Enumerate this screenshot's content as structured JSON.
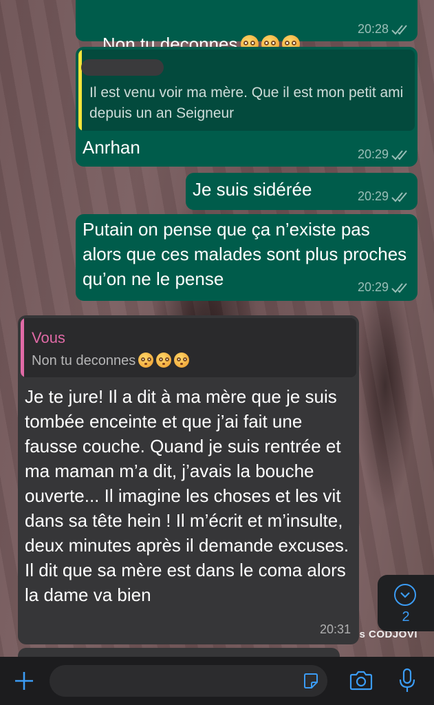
{
  "messages": [
    {
      "text": "Non tu deconnes",
      "emoji": [
        "flushed-face",
        "flushed-face",
        "flushed-face"
      ],
      "time": "20:28"
    },
    {
      "quote": {
        "sender": "",
        "text": "Il est venu voir ma mère. Que il est mon petit ami depuis un an Seigneur"
      },
      "text": "Anrhan",
      "time": "20:29"
    },
    {
      "text": "Je suis sidérée",
      "time": "20:29"
    },
    {
      "text": "Putain on pense que ça n’existe pas alors que ces malades sont plus proches qu’on ne le pense",
      "time": "20:29"
    },
    {
      "quote": {
        "sender": "Vous",
        "text": "Non tu deconnes",
        "emoji": [
          "flushed-face",
          "flushed-face",
          "flushed-face"
        ]
      },
      "text": "Je te jure! Il a dit à ma mère que je suis tombée enceinte et que j’ai fait une fausse couche. Quand je suis rentrée et ma maman m’a dit, j’avais la bouche ouverte... Il imagine les choses et les vit dans sa tête hein ! Il m’écrit et m’insulte, deux minutes après il demande excuses. Il dit que sa mère est dans le coma alors la dame va bien",
      "time": "20:31"
    }
  ],
  "scroll_button": {
    "count": "2",
    "icon": "chevron-down-icon"
  },
  "watermark": "os CODJOVI",
  "composer": {
    "plus_icon": "plus-icon",
    "sticker_icon": "sticker-icon",
    "camera_icon": "camera-icon",
    "mic_icon": "microphone-icon"
  },
  "colors": {
    "outgoing_bubble": "#005c4b",
    "incoming_bubble": "#363638",
    "quote_bar_outgoing": "#f5e53a",
    "quote_bar_incoming": "#e06aa6",
    "accent": "#3b9cf5"
  }
}
